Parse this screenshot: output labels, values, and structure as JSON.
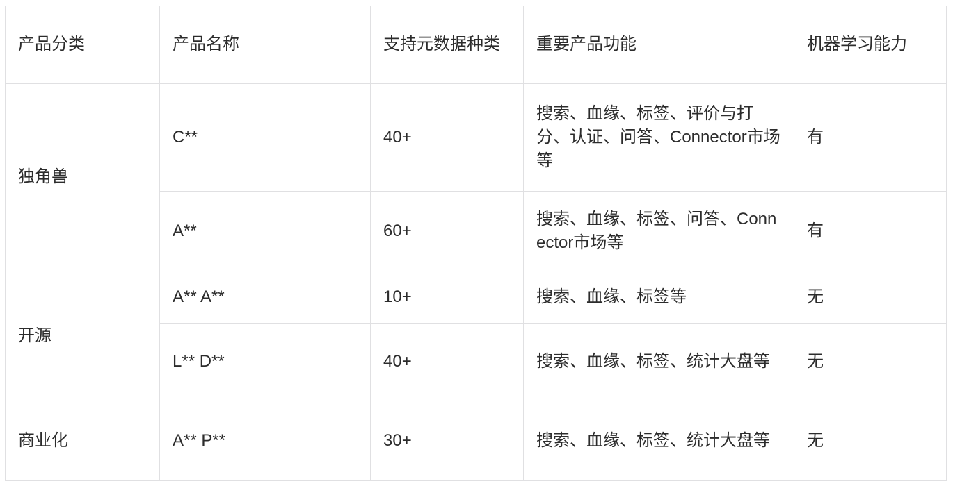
{
  "table": {
    "columns": [
      {
        "key": "category",
        "label": "产品分类"
      },
      {
        "key": "name",
        "label": "产品名称"
      },
      {
        "key": "meta",
        "label": "支持元数据种类"
      },
      {
        "key": "features",
        "label": "重要产品功能"
      },
      {
        "key": "ml",
        "label": "机器学习能力"
      }
    ],
    "rows": [
      {
        "category": "独角兽",
        "category_rowspan": 2,
        "name": "C**",
        "meta": "40+",
        "features": "搜索、血缘、标签、评价与打分、认证、问答、Connector市场等",
        "ml": "有"
      },
      {
        "category": null,
        "name": "A**",
        "meta": "60+",
        "features": "搜索、血缘、标签、问答、Connector市场等",
        "ml": "有"
      },
      {
        "category": "开源",
        "category_rowspan": 2,
        "name": "A** A**",
        "meta": "10+",
        "features": "搜索、血缘、标签等",
        "ml": "无"
      },
      {
        "category": null,
        "name": "L** D**",
        "meta": "40+",
        "features": "搜索、血缘、标签、统计大盘等",
        "ml": "无"
      },
      {
        "category": "商业化",
        "category_rowspan": 1,
        "name": "A** P**",
        "meta": "30+",
        "features": "搜索、血缘、标签、统计大盘等",
        "ml": "无"
      }
    ]
  },
  "style": {
    "border_color": "#e0e0e2",
    "text_color": "#2c2c2c",
    "background": "#ffffff"
  }
}
